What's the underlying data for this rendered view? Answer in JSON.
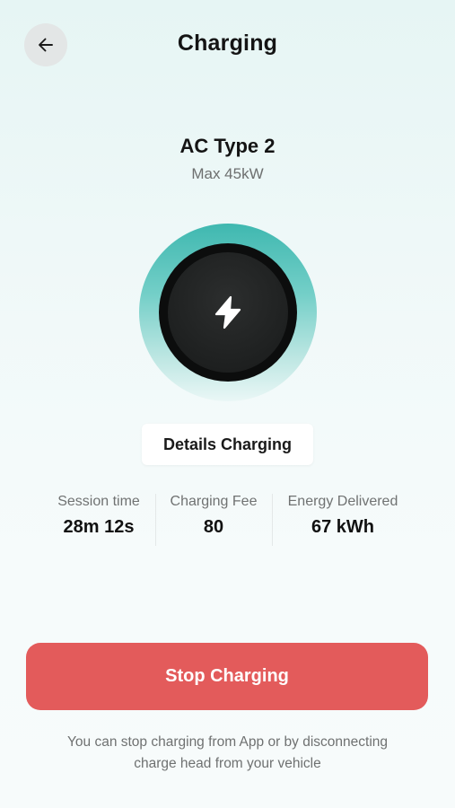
{
  "header": {
    "title": "Charging",
    "back_icon": "arrow-left-icon"
  },
  "connector": {
    "name": "AC Type 2",
    "max_power": "Max 45kW"
  },
  "status": {
    "icon": "lightning-bolt-icon",
    "accent_color": "#3fb8b0"
  },
  "details_button": {
    "label": "Details Charging"
  },
  "stats": [
    {
      "label": "Session time",
      "value": "28m 12s"
    },
    {
      "label": "Charging Fee",
      "value": "80"
    },
    {
      "label": "Energy Delivered",
      "value": "67 kWh"
    }
  ],
  "stop_button": {
    "label": "Stop Charging",
    "color": "#e35b5b"
  },
  "hint": {
    "line1": "You can stop charging from App or by disconnecting",
    "line2": "charge head from your vehicle"
  }
}
